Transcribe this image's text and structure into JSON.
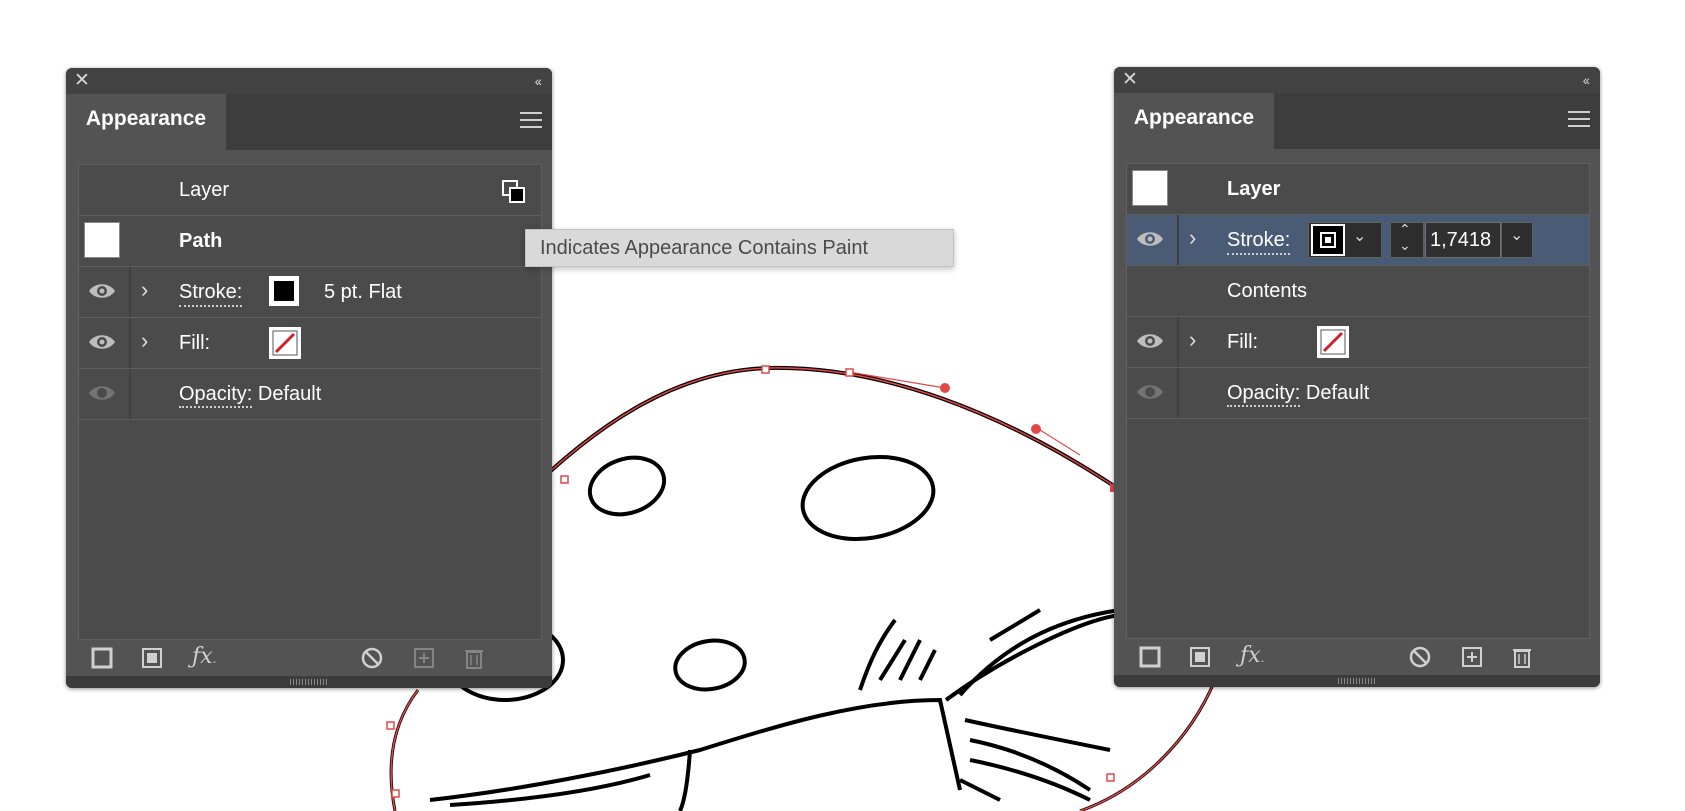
{
  "tooltip": "Indicates Appearance Contains Paint",
  "left_panel": {
    "tab": "Appearance",
    "rows": {
      "layer_label": "Layer",
      "path_label": "Path",
      "stroke_label": "Stroke:",
      "stroke_value": "5 pt. Flat",
      "fill_label": "Fill:",
      "opacity_label": "Opacity:",
      "opacity_value": "Default"
    }
  },
  "right_panel": {
    "tab": "Appearance",
    "rows": {
      "layer_label": "Layer",
      "stroke_label": "Stroke:",
      "stroke_weight": "1,7418",
      "contents_label": "Contents",
      "fill_label": "Fill:",
      "opacity_label": "Opacity:",
      "opacity_value": "Default"
    }
  },
  "colors": {
    "panel_bg": "#535353",
    "selection_bg": "#4a5c75",
    "path_highlight": "#e04848",
    "none_slash": "#d0202e"
  }
}
